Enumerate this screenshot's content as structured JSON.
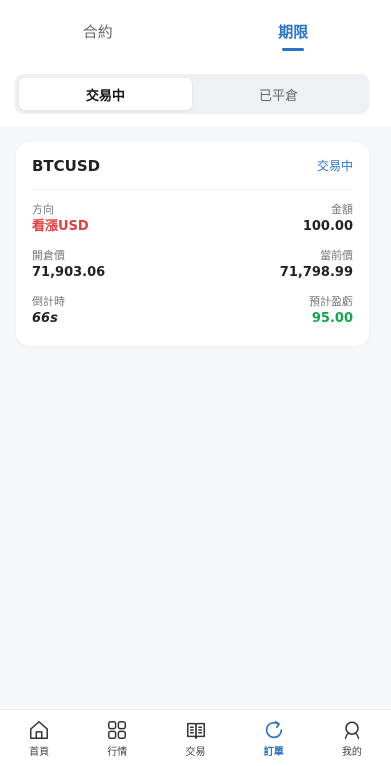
{
  "header": {
    "tabs": [
      {
        "label": "合約",
        "active": false
      },
      {
        "label": "期限",
        "active": true
      }
    ]
  },
  "segment": {
    "items": [
      {
        "label": "交易中",
        "active": true
      },
      {
        "label": "已平倉",
        "active": false
      }
    ]
  },
  "order_card": {
    "symbol": "BTCUSD",
    "status": "交易中",
    "direction_label": "方向",
    "direction_value": "看漲USD",
    "amount_label": "金額",
    "amount_value": "100.00",
    "open_price_label": "開倉價",
    "open_price_value": "71,903.06",
    "current_price_label": "當前價",
    "current_price_value": "71,798.99",
    "countdown_label": "倒計時",
    "countdown_value": "66s",
    "est_profit_label": "預計盈虧",
    "est_profit_value": "95.00"
  },
  "bottom_nav": {
    "items": [
      {
        "label": "首頁",
        "icon": "home-icon",
        "active": false
      },
      {
        "label": "行情",
        "icon": "grid-icon",
        "active": false
      },
      {
        "label": "交易",
        "icon": "book-icon",
        "active": false
      },
      {
        "label": "訂單",
        "icon": "refresh-icon",
        "active": true
      },
      {
        "label": "我的",
        "icon": "user-icon",
        "active": false
      }
    ]
  },
  "colors": {
    "accent": "#2b73c6",
    "up_red": "#e0403f",
    "profit_green": "#13a54b"
  }
}
